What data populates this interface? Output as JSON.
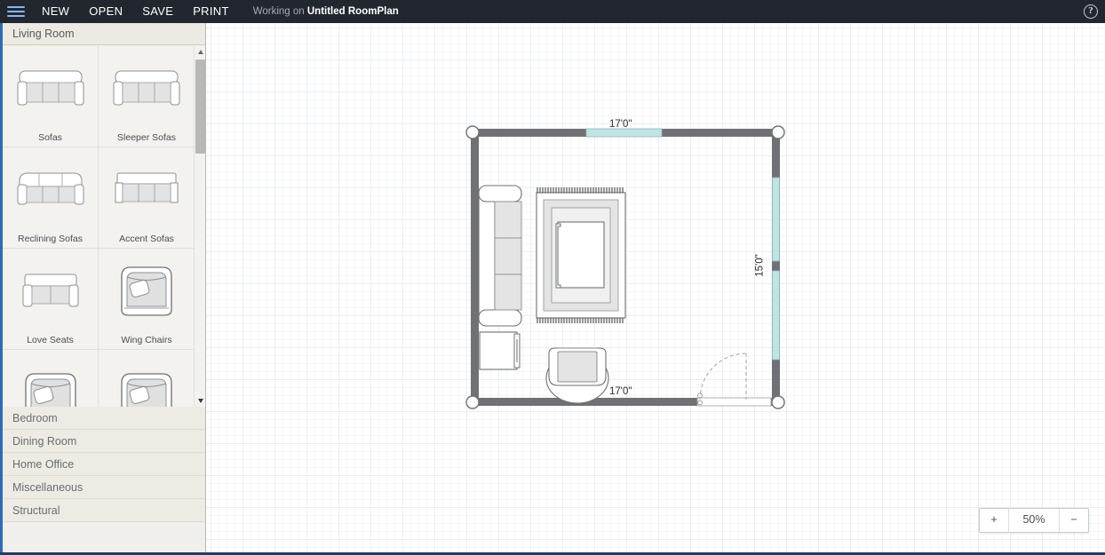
{
  "topbar": {
    "menu_icon": "hamburger-icon",
    "items": [
      {
        "id": "new",
        "label": "NEW"
      },
      {
        "id": "open",
        "label": "OPEN"
      },
      {
        "id": "save",
        "label": "SAVE"
      },
      {
        "id": "print",
        "label": "PRINT"
      }
    ],
    "status_prefix": "Working on",
    "status_document": "Untitled RoomPlan",
    "help_label": "?",
    "background_color": "#22262e",
    "accent_color": "#8ab4f8"
  },
  "sidebar": {
    "active_category": "Living Room",
    "items": [
      {
        "id": "sofas",
        "label": "Sofas",
        "icon": "sofa-icon"
      },
      {
        "id": "sleeper-sofas",
        "label": "Sleeper Sofas",
        "icon": "sleeper-sofa-icon"
      },
      {
        "id": "reclining-sofas",
        "label": "Reclining Sofas",
        "icon": "reclining-sofa-icon"
      },
      {
        "id": "accent-sofas",
        "label": "Accent Sofas",
        "icon": "accent-sofa-icon"
      },
      {
        "id": "love-seats",
        "label": "Love Seats",
        "icon": "love-seat-icon"
      },
      {
        "id": "wing-chairs",
        "label": "Wing Chairs",
        "icon": "wing-chair-icon"
      },
      {
        "id": "chairs-a",
        "label": "",
        "icon": "wing-chair-icon"
      },
      {
        "id": "chairs-b",
        "label": "",
        "icon": "wing-chair-icon"
      }
    ],
    "categories": [
      {
        "id": "bedroom",
        "label": "Bedroom"
      },
      {
        "id": "dining-room",
        "label": "Dining Room"
      },
      {
        "id": "home-office",
        "label": "Home Office"
      },
      {
        "id": "miscellaneous",
        "label": "Miscellaneous"
      },
      {
        "id": "structural",
        "label": "Structural"
      }
    ],
    "scrollbar": {
      "up_icon": "triangle-up-icon",
      "down_icon": "triangle-down-icon"
    },
    "accent_color": "#2e6bb5"
  },
  "canvas": {
    "zoom": {
      "in_label": "+",
      "out_label": "−",
      "value": "50%"
    },
    "plan": {
      "room_width_label": "17'0\"",
      "room_height_label": "15'0\"",
      "room_bottom_label": "17'0\"",
      "wall_color": "#6f7175",
      "window_color": "#bfe4e4",
      "handle_color": "#ffffff",
      "furniture": [
        {
          "id": "sofa",
          "name": "sofa"
        },
        {
          "id": "rug",
          "name": "area-rug"
        },
        {
          "id": "coffee-table",
          "name": "coffee-table"
        },
        {
          "id": "end-table",
          "name": "end-table"
        },
        {
          "id": "armchair",
          "name": "armchair"
        },
        {
          "id": "door",
          "name": "door"
        }
      ]
    }
  }
}
